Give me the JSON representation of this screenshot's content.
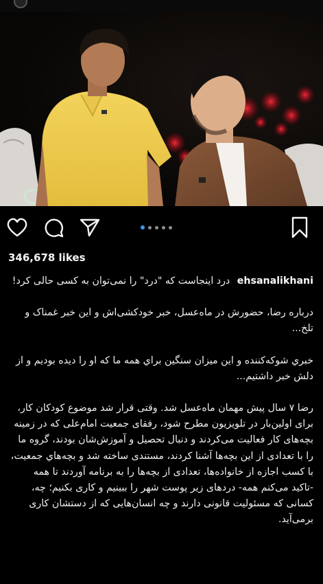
{
  "post": {
    "image_description_icon": "photo",
    "carousel": {
      "count": 5,
      "active_index": 0
    }
  },
  "actions": {
    "like_icon": "heart-icon",
    "comment_icon": "comment-icon",
    "share_icon": "send-icon",
    "save_icon": "bookmark-icon"
  },
  "likes": {
    "label": "346,678 likes"
  },
  "caption": {
    "username": "ehsanalikhani",
    "first_line": "درد اینجاست که \"درد\" را نمی‌توان به کسی حالی کرد!",
    "paragraphs": [
      "درباره رضا، حضورش در ماه‌عسل، خبر خودکشی‌اش و این خبر غمناک و تلخ...",
      "خبري شوكه‌كننده و اين ميزان سنگين براي همه ما كه او را ديده بوديم و از دلش خبر داشتيم...",
      "رضا ۷ سال پیش مهمان ماه‌عسل شد. وقتی قرار شد موضوع کودکان کار، برای اولین‌بار در تلویزیون مطرح شود، رفقای جمعیت امام‌علی که در زمینه بچه‌های کار فعالیت می‌کردند و دنبال تحصیل و آموزش‌شان بودند، گروه ما را با تعدادی از این بچه‌ها آشنا کردند، مستندی ساخته شد و بچه‌هاي جمعيت، با کسب اجازه از خانواده‌ها، تعدادی از بچه‌ها را به برنامه آوردند تا همه -تاکید می‌کنم همه- دردهای زیر پوست شهر را ببینیم و کاری بکنیم؛ چه، کسانی که مسئولیت قانونی دارند و چه انسان‌هایی که از دستشان کاری برمی‌آید."
    ]
  },
  "colors": {
    "background": "#000000",
    "text": "#f0f0f0",
    "carousel_active": "#3897f0",
    "carousel_inactive": "#8e8e8e"
  }
}
